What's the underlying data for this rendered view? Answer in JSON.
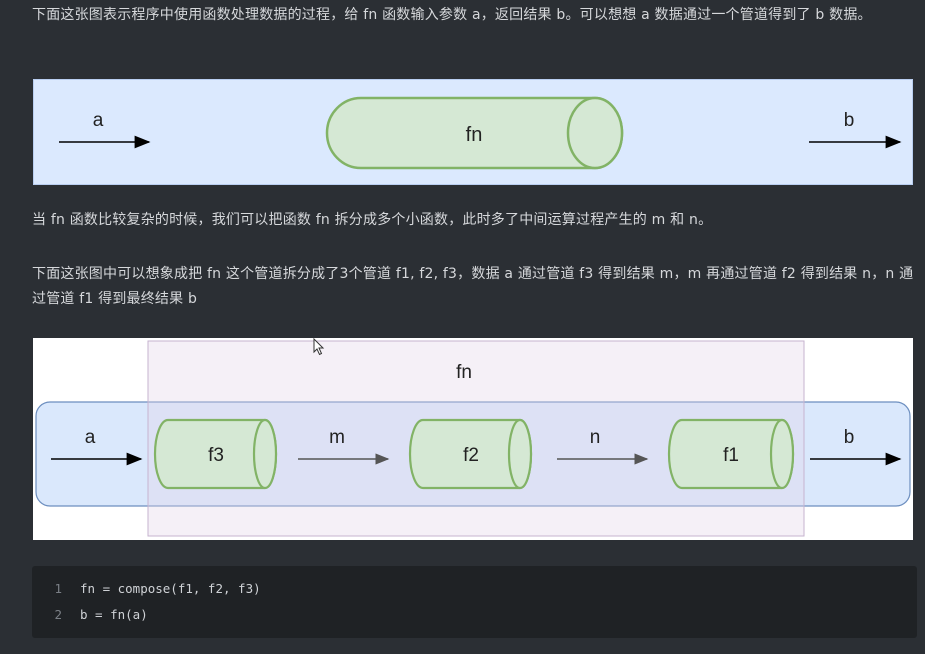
{
  "paragraphs": {
    "intro": "下面这张图表示程序中使用函数处理数据的过程，给 fn 函数输入参数 a，返回结果 b。可以想想 a 数据通过一个管道得到了 b 数据。",
    "complex": "当 fn 函数比较复杂的时候，我们可以把函数 fn 拆分成多个小函数，此时多了中间运算过程产生的 m 和 n。",
    "split": "下面这张图中可以想象成把 fn 这个管道拆分成了3个管道 f1, f2, f3，数据 a 通过管道 f3 得到结果 m，m 再通过管道 f2 得到结果 n，n 通过管道 f1 得到最终结果 b"
  },
  "figure1": {
    "input_label": "a",
    "pipe_label": "fn",
    "output_label": "b"
  },
  "figure2": {
    "group_label": "fn",
    "input_label": "a",
    "pipe1_label": "f3",
    "mid1_label": "m",
    "pipe2_label": "f2",
    "mid2_label": "n",
    "pipe3_label": "f1",
    "output_label": "b"
  },
  "code": {
    "lines": [
      {
        "num": "1",
        "text": "fn = compose(f1, f2, f3)"
      },
      {
        "num": "2",
        "text": "b = fn(a)"
      }
    ]
  },
  "colors": {
    "page_bg": "#2b2f34",
    "pipe_fill": "#d5e8d4",
    "pipe_stroke": "#82b366",
    "flow_fill": "#dae8fc",
    "flow_stroke": "#6c8ebf",
    "group_fill": "#e1d5e7",
    "code_bg": "#1f2225"
  }
}
